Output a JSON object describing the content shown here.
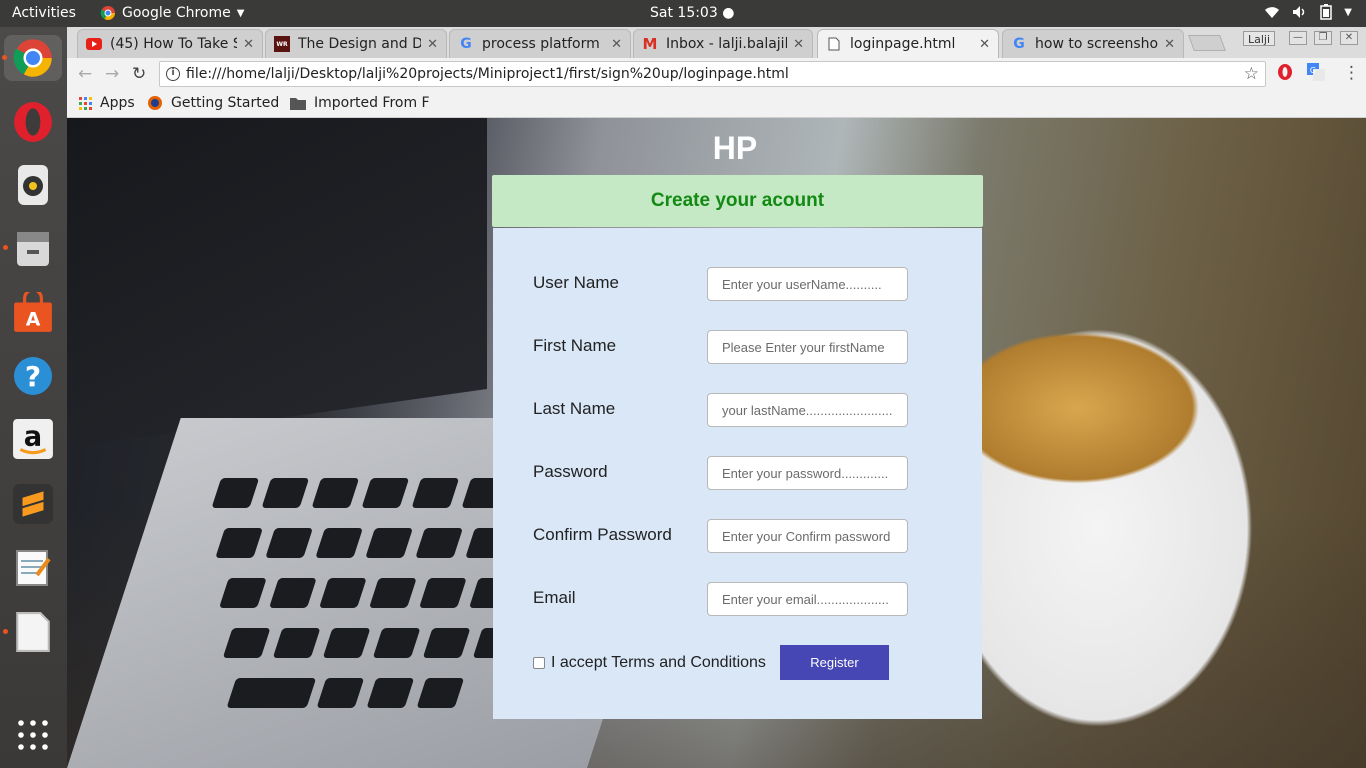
{
  "topbar": {
    "activities": "Activities",
    "app_name": "Google Chrome",
    "clock": "Sat 15:03"
  },
  "tabs": [
    {
      "title": "(45) How To Take S",
      "icon": "youtube-icon",
      "active": false
    },
    {
      "title": "The Design and D",
      "icon": "ebook-icon",
      "active": false
    },
    {
      "title": "process platform",
      "icon": "google-icon",
      "active": false
    },
    {
      "title": "Inbox - lalji.balajib",
      "icon": "gmail-icon",
      "active": false
    },
    {
      "title": "loginpage.html",
      "icon": "file-icon",
      "active": true
    },
    {
      "title": "how to screensho",
      "icon": "google-icon",
      "active": false
    }
  ],
  "window": {
    "user": "Lalji"
  },
  "address_bar": {
    "url": "file:///home/lalji/Desktop/lalji%20projects/Miniproject1/first/sign%20up/loginpage.html"
  },
  "bookmarks": [
    {
      "label": "Apps",
      "icon": "apps-grid-icon"
    },
    {
      "label": "Getting Started",
      "icon": "firefox-icon"
    },
    {
      "label": "Imported From F",
      "icon": "folder-icon"
    }
  ],
  "page": {
    "brand": "HP",
    "form_title": "Create your acount",
    "fields": {
      "username": {
        "label": "User Name",
        "placeholder": "Enter your userName.........."
      },
      "firstname": {
        "label": "First Name",
        "placeholder": "Please Enter your firstName"
      },
      "lastname": {
        "label": "Last Name",
        "placeholder": "your lastName........................"
      },
      "password": {
        "label": "Password",
        "placeholder": "Enter your password............."
      },
      "confirm": {
        "label": "Confirm Password",
        "placeholder": "Enter your Confirm password"
      },
      "email": {
        "label": "Email",
        "placeholder": "Enter your email...................."
      }
    },
    "terms": "I accept Terms and Conditions",
    "register": "Register"
  },
  "colors": {
    "form_header_bg": "#c5e8c5",
    "form_header_text": "#138a13",
    "form_body_bg": "#d9e7f7",
    "register_bg": "#4646b4"
  }
}
